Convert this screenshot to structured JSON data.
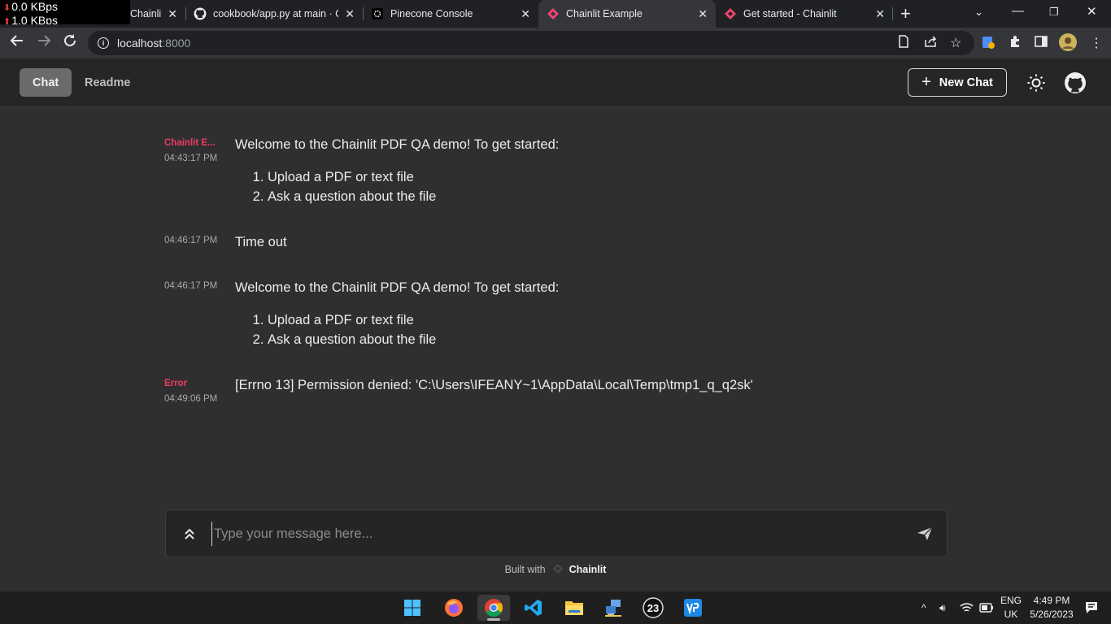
{
  "netspeed": {
    "down": "0.0 KBps",
    "up": "1.0 KBps"
  },
  "browser": {
    "tabs": [
      {
        "title": "Chainlit",
        "favicon": "chainlit-icon"
      },
      {
        "title": "cookbook/app.py at main · C",
        "favicon": "github-icon"
      },
      {
        "title": "Pinecone Console",
        "favicon": "pinecone-icon"
      },
      {
        "title": "Chainlit Example",
        "favicon": "chainlit-icon",
        "active": true
      },
      {
        "title": "Get started - Chainlit",
        "favicon": "chainlit-icon"
      }
    ],
    "url_host": "localhost",
    "url_port": ":8000"
  },
  "app": {
    "nav": [
      {
        "label": "Chat",
        "active": true
      },
      {
        "label": "Readme",
        "active": false
      }
    ],
    "new_chat_label": "New Chat",
    "accent_color": "#ef3b62",
    "messages": [
      {
        "author": "Chainlit E...",
        "time": "04:43:17 PM",
        "text": "Welcome to the Chainlit PDF QA demo! To get started:",
        "list": [
          "Upload a PDF or text file",
          "Ask a question about the file"
        ]
      },
      {
        "author": "",
        "time": "04:46:17 PM",
        "text": "Time out"
      },
      {
        "author": "",
        "time": "04:46:17 PM",
        "text": "Welcome to the Chainlit PDF QA demo! To get started:",
        "list": [
          "Upload a PDF or text file",
          "Ask a question about the file"
        ]
      },
      {
        "author": "Error",
        "time": "04:49:06 PM",
        "text": "[Errno 13] Permission denied: 'C:\\Users\\IFEANY~1\\AppData\\Local\\Temp\\tmp1_q_q2sk'"
      }
    ],
    "composer_placeholder": "Type your message here...",
    "footer": {
      "prefix": "Built with",
      "brand": "Chainlit"
    }
  },
  "taskbar": {
    "apps": [
      "windows-start-icon",
      "firefox-icon",
      "chrome-icon",
      "vscode-icon",
      "file-explorer-icon",
      "network-app-icon",
      "app-23-icon",
      "vmware-icon"
    ],
    "lang_top": "ENG",
    "lang_bottom": "UK",
    "time": "4:49 PM",
    "date": "5/26/2023",
    "app_badge": "23"
  }
}
